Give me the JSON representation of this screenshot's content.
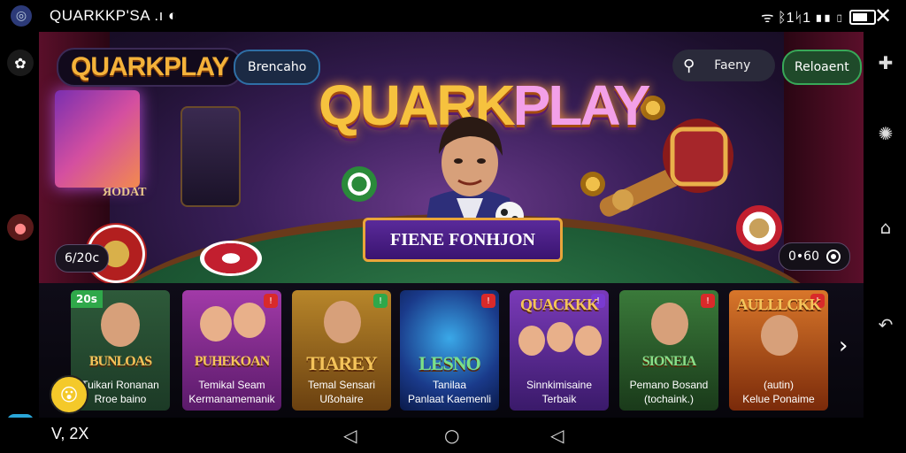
{
  "status_bar": {
    "app_title": "QUARKKP'SA .ı ◐",
    "right_text": "ᯤ ᛒ1ᛋ1 ▮▮ ▯"
  },
  "header": {
    "logo_text": "QUARKPLAY",
    "chip_button": "Brencaho",
    "search_placeholder": "Faeny",
    "reload_button": "Reloaent"
  },
  "hero": {
    "title_a": "QUARK",
    "title_b": "PLAY",
    "banner": "FIENE FONHJON",
    "screen_text": "ЯODAT",
    "badge_left": "6/20c",
    "badge_right": "0•60"
  },
  "cards": [
    {
      "title": "BUNLOAS",
      "sub1": "Tuikari Ronanan",
      "sub2": "Rroe baino",
      "corner_tl": "20s"
    },
    {
      "title": "PUHEKOAN",
      "sub1": "Temikal Seam",
      "sub2": "Kermanamemanik",
      "corner": "!"
    },
    {
      "title": "TIAREY",
      "sub1": "Temal Sensari",
      "sub2": "Ußohaire",
      "corner": "!"
    },
    {
      "title": "LESNO",
      "sub1": "Tanilaa",
      "sub2": "Panlaat Kaemenli",
      "corner": "!"
    },
    {
      "title": "QUACKKK",
      "sub1": "Sinnkimisaine",
      "sub2": "Terbaik",
      "corner": "!"
    },
    {
      "title": "SIONEIA",
      "sub1": "Pemano Bosand",
      "sub2": "(tochaink.)",
      "corner": "!"
    },
    {
      "title": "AULLLCKK",
      "sub1": "(autin)",
      "sub2": "Kelue Ponaime",
      "corner": "!"
    }
  ],
  "emoji_badge": "😮",
  "bottom_left_text": "V, 2X",
  "icons": {
    "status_app": "globe-icon",
    "left_top": "gear-icon",
    "left_mid": "avatar-icon",
    "left_bottom": "checkmark-app-icon",
    "right_1": "puzzle-icon",
    "right_2": "settings-icon",
    "right_3": "home-icon",
    "right_4": "back-arrow-icon",
    "right_5": "grid-icon"
  },
  "colors": {
    "accent_gold": "#f6c23e",
    "accent_purple": "#5a2a9a",
    "reload_green": "#38a858",
    "chip_blue": "#2f6fa6"
  }
}
